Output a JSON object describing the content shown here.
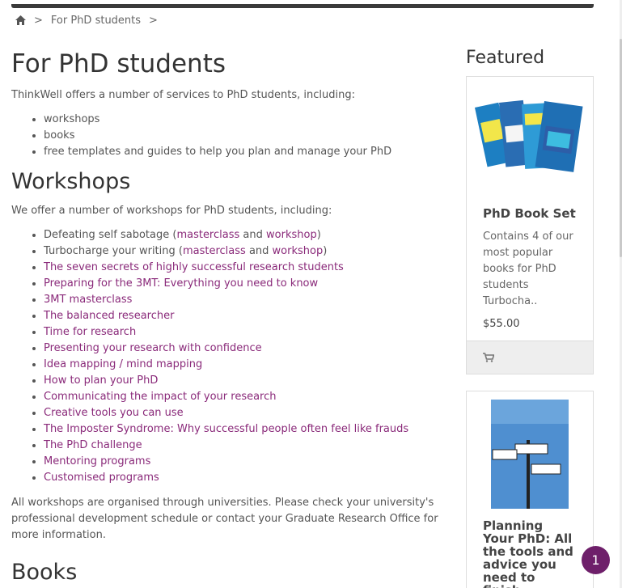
{
  "header": {
    "cart_label": "Shopping Cart"
  },
  "breadcrumb": {
    "sep1": ">",
    "current": "For PhD students",
    "sep2": ">"
  },
  "main": {
    "title": "For PhD students",
    "intro": "ThinkWell offers a number of services to PhD students, including:",
    "services": [
      "workshops",
      "books",
      "free templates and guides to help you plan and manage your PhD"
    ],
    "workshops_heading": "Workshops",
    "workshops_intro": "We offer a number of workshops for PhD students, including:",
    "workshop1": {
      "text": "Defeating self sabotage (",
      "masterclass": "masterclass",
      "and": " and ",
      "workshop": "workshop",
      "close": ")"
    },
    "workshop2": {
      "text": "Turbocharge your writing (",
      "masterclass": "masterclass",
      "and": " and ",
      "workshop": "workshop",
      "close": ")"
    },
    "workshop_links": [
      "The seven secrets of highly successful research students",
      "Preparing for the 3MT: Everything you need to know",
      "3MT masterclass",
      "The balanced researcher",
      "Time for research",
      "Presenting your research with confidence",
      "Idea mapping / mind mapping",
      "How to plan your PhD",
      "Communicating the impact of your research",
      "Creative tools you can use",
      "The Imposter Syndrome: Why successful people often feel like frauds",
      "The PhD challenge",
      "Mentoring programs",
      "Customised programs"
    ],
    "workshops_note": "All workshops are organised through universities. Please check your university's professional development schedule or contact your Graduate Research Office for more information.",
    "books_heading": "Books"
  },
  "sidebar": {
    "heading": "Featured",
    "product1": {
      "title": "PhD Book Set",
      "description": "Contains 4 of our most popular books for PhD students Turbocha..",
      "price": "$55.00"
    },
    "product2": {
      "title": "Planning Your PhD: All the tools and advice you need to finish"
    }
  },
  "chat_badge": "1",
  "colors": {
    "link": "#8a2a7a",
    "badge": "#6e1f6a"
  }
}
